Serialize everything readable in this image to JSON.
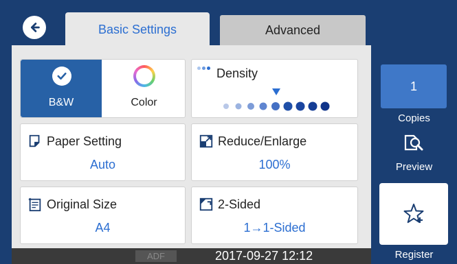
{
  "header": {
    "tabs": [
      {
        "label": "Basic Settings",
        "active": true
      },
      {
        "label": "Advanced",
        "active": false
      }
    ]
  },
  "color_mode": {
    "options": [
      {
        "label": "B&W",
        "selected": true,
        "icon": "check-icon"
      },
      {
        "label": "Color",
        "selected": false,
        "icon": "color-ring-icon"
      }
    ]
  },
  "density": {
    "label": "Density",
    "level_index": 5,
    "levels": 9
  },
  "paper_setting": {
    "label": "Paper Setting",
    "value": "Auto"
  },
  "reduce_enlarge": {
    "label": "Reduce/Enlarge",
    "value": "100%"
  },
  "original_size": {
    "label": "Original Size",
    "value": "A4"
  },
  "two_sided": {
    "label": "2-Sided",
    "value": "1→1-Sided"
  },
  "status": {
    "adf": "ADF",
    "datetime": "2017-09-27 12:12"
  },
  "sidebar": {
    "copies_value": "1",
    "copies_label": "Copies",
    "preview_label": "Preview",
    "register_label": "Register"
  },
  "colors": {
    "accent": "#2b6ed1",
    "header": "#1a3e72",
    "selected": "#2761a6",
    "copies_bg": "#3f78c8"
  }
}
